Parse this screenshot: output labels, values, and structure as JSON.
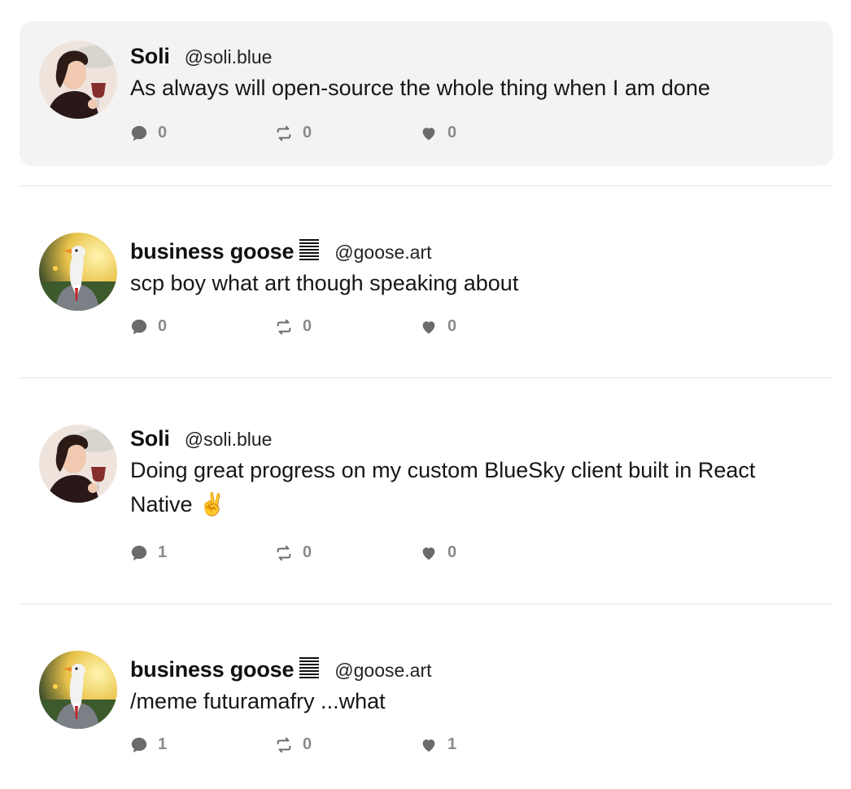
{
  "posts": [
    {
      "author": "Soli",
      "handle": "@soli.blue",
      "avatar": "woman-with-wine-avatar",
      "badge": false,
      "text": "As always will open-source the whole thing when I am done",
      "replies": "0",
      "reposts": "0",
      "likes": "0",
      "highlighted": true
    },
    {
      "author": "business goose",
      "handle": "@goose.art",
      "avatar": "goose-in-suit-avatar",
      "badge": true,
      "text": "scp boy what art though speaking about",
      "replies": "0",
      "reposts": "0",
      "likes": "0",
      "highlighted": false
    },
    {
      "author": "Soli",
      "handle": "@soli.blue",
      "avatar": "woman-with-wine-avatar",
      "badge": false,
      "text": "Doing great progress on my custom BlueSky client built in React Native ✌️",
      "replies": "1",
      "reposts": "0",
      "likes": "0",
      "highlighted": false
    },
    {
      "author": "business goose",
      "handle": "@goose.art",
      "avatar": "goose-in-suit-avatar",
      "badge": true,
      "text": "/meme futuramafry ...what",
      "replies": "1",
      "reposts": "0",
      "likes": "1",
      "highlighted": false
    }
  ],
  "colors": {
    "highlight": "#f3f3f3",
    "divider": "#e6e6e6",
    "action": "#8a8a8a"
  }
}
